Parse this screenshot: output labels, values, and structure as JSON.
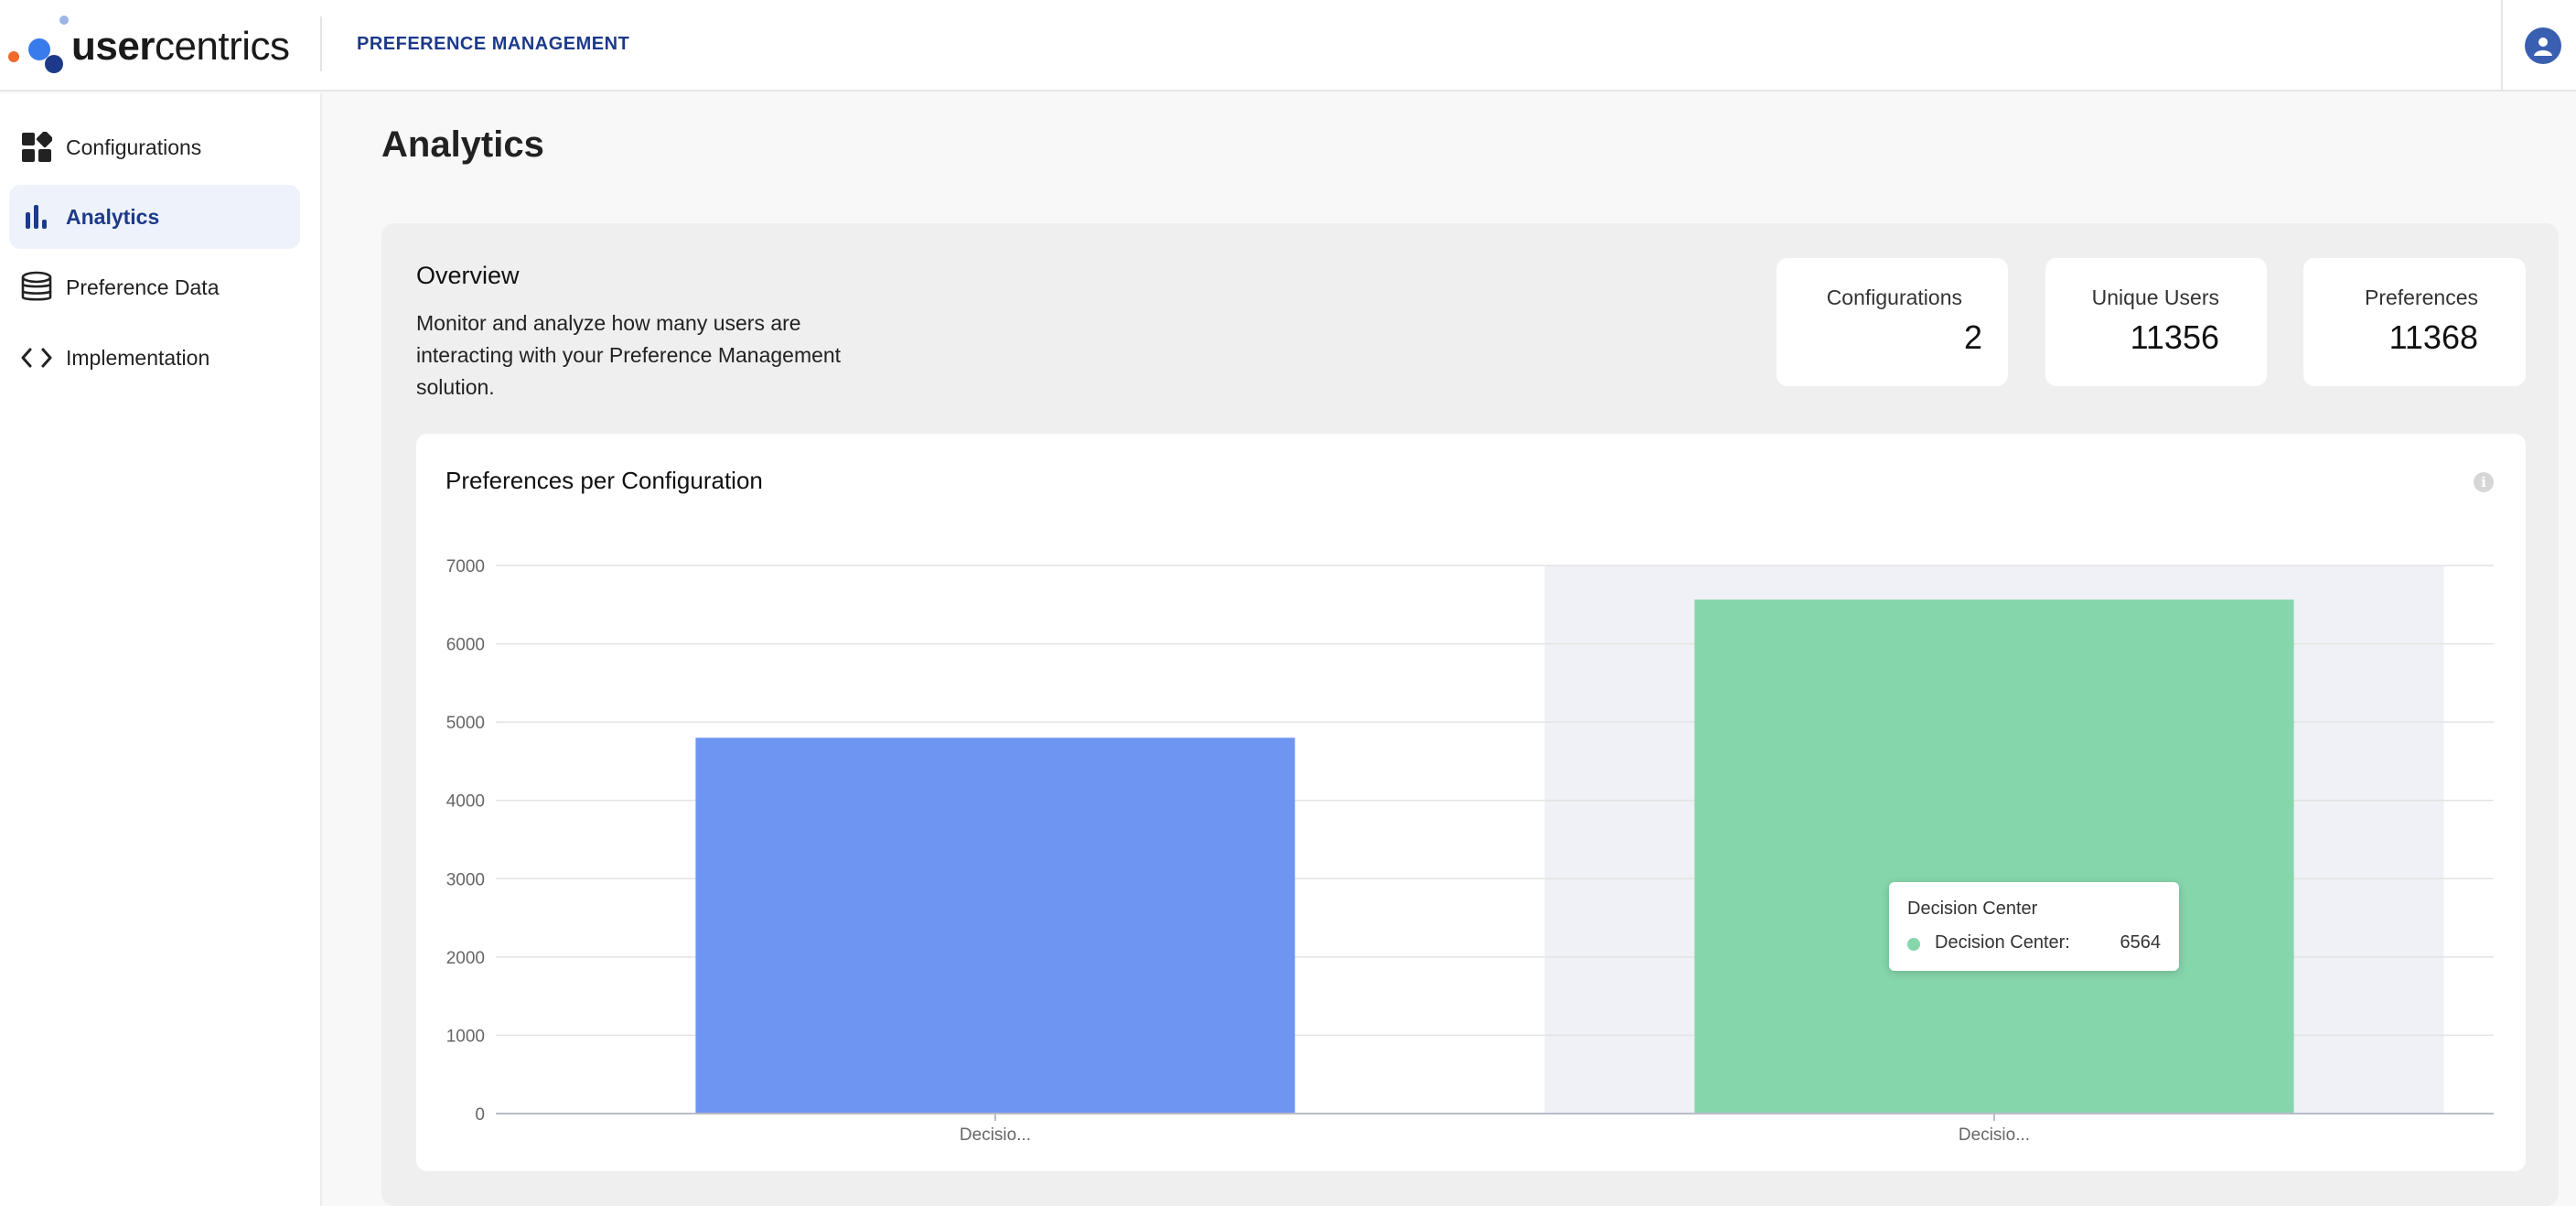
{
  "header": {
    "logo_text_bold": "user",
    "logo_text_regular": "centrics",
    "product": "PREFERENCE MANAGEMENT",
    "user_icon": "user-circle-icon"
  },
  "sidebar": {
    "items": [
      {
        "label": "Configurations",
        "icon": "dashboard-grid-icon",
        "active": false
      },
      {
        "label": "Analytics",
        "icon": "bar-chart-icon",
        "active": true
      },
      {
        "label": "Preference Data",
        "icon": "database-icon",
        "active": false
      },
      {
        "label": "Implementation",
        "icon": "code-brackets-icon",
        "active": false
      }
    ]
  },
  "page": {
    "title": "Analytics"
  },
  "overview": {
    "title": "Overview",
    "description": "Monitor and analyze how many users are interacting with your Preference Management solution.",
    "stats": [
      {
        "label": "Configurations",
        "value": "2"
      },
      {
        "label": "Unique Users",
        "value": "11356"
      },
      {
        "label": "Preferences",
        "value": "11368"
      }
    ]
  },
  "chart_card": {
    "title": "Preferences per Configuration",
    "info_icon": "info-icon"
  },
  "chart_data": {
    "type": "bar",
    "categories": [
      "Decisio...",
      "Decisio..."
    ],
    "values": [
      4800,
      6564
    ],
    "colors": [
      "#6f95f2",
      "#86d6ac"
    ],
    "ylim": [
      0,
      7000
    ],
    "yticks": [
      0,
      1000,
      2000,
      3000,
      4000,
      5000,
      6000,
      7000
    ],
    "grid": true,
    "highlighted_index": 1,
    "title": "",
    "xlabel": "",
    "ylabel": ""
  },
  "tooltip": {
    "title": "Decision Center",
    "series_name": "Decision Center:",
    "value": "6564",
    "color": "#86d6ac"
  }
}
